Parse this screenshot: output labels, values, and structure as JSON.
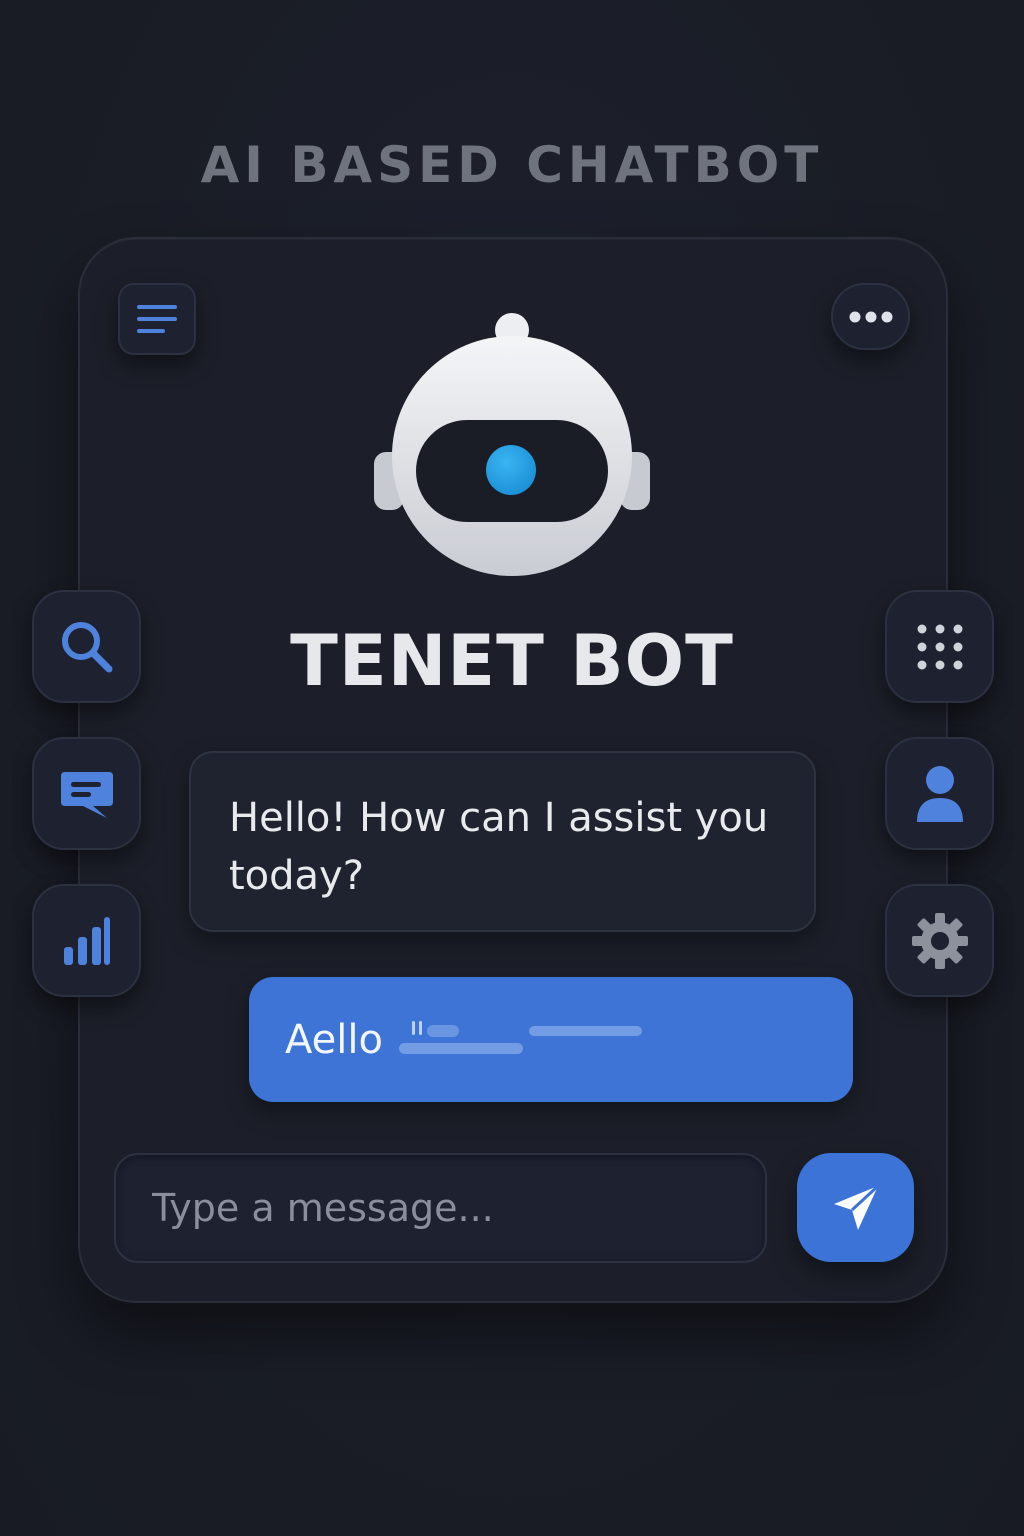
{
  "page": {
    "heading": "AI BASED CHATBOT"
  },
  "header": {
    "menu_icon": "hamburger-menu-icon",
    "more_icon": "more-horizontal-icon"
  },
  "bot": {
    "name": "TENET BOT",
    "avatar_icon": "robot-icon"
  },
  "left_toolbar": [
    {
      "icon": "search-icon"
    },
    {
      "icon": "chat-bubble-icon"
    },
    {
      "icon": "bar-chart-icon"
    }
  ],
  "right_toolbar": [
    {
      "icon": "grid-dots-icon"
    },
    {
      "icon": "user-icon"
    },
    {
      "icon": "gear-icon"
    }
  ],
  "messages": [
    {
      "sender": "bot",
      "text": "Hello! How can I assist you today?"
    },
    {
      "sender": "user",
      "text": "Aello"
    }
  ],
  "composer": {
    "placeholder": "Type a message...",
    "value": "",
    "send_icon": "send-icon"
  },
  "colors": {
    "background": "#1a1d26",
    "card": "#1c1f29",
    "accent": "#3d74d6",
    "heading": "#6f737d",
    "text": "#e8eaee"
  }
}
